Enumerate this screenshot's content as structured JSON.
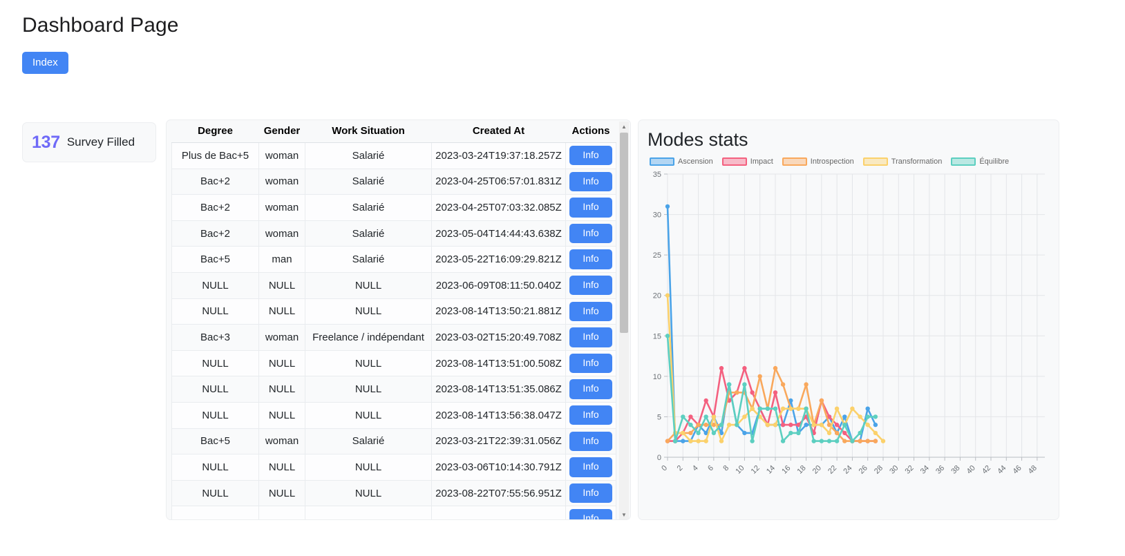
{
  "header": {
    "title": "Dashboard Page",
    "index_button": "Index"
  },
  "stat_card": {
    "number": "137",
    "label": "Survey Filled",
    "number_color": "#6f6af8"
  },
  "table": {
    "columns": [
      "Degree",
      "Gender",
      "Work Situation",
      "Created At",
      "Actions"
    ],
    "action_label": "Info",
    "action_color": "#4285f4",
    "rows": [
      {
        "degree": "Plus de Bac+5",
        "gender": "woman",
        "work": "Salarié",
        "created": "2023-03-24T19:37:18.257Z"
      },
      {
        "degree": "Bac+2",
        "gender": "woman",
        "work": "Salarié",
        "created": "2023-04-25T06:57:01.831Z"
      },
      {
        "degree": "Bac+2",
        "gender": "woman",
        "work": "Salarié",
        "created": "2023-04-25T07:03:32.085Z"
      },
      {
        "degree": "Bac+2",
        "gender": "woman",
        "work": "Salarié",
        "created": "2023-05-04T14:44:43.638Z"
      },
      {
        "degree": "Bac+5",
        "gender": "man",
        "work": "Salarié",
        "created": "2023-05-22T16:09:29.821Z"
      },
      {
        "degree": "NULL",
        "gender": "NULL",
        "work": "NULL",
        "created": "2023-06-09T08:11:50.040Z"
      },
      {
        "degree": "NULL",
        "gender": "NULL",
        "work": "NULL",
        "created": "2023-08-14T13:50:21.881Z"
      },
      {
        "degree": "Bac+3",
        "gender": "woman",
        "work": "Freelance / indépendant",
        "created": "2023-03-02T15:20:49.708Z"
      },
      {
        "degree": "NULL",
        "gender": "NULL",
        "work": "NULL",
        "created": "2023-08-14T13:51:00.508Z"
      },
      {
        "degree": "NULL",
        "gender": "NULL",
        "work": "NULL",
        "created": "2023-08-14T13:51:35.086Z"
      },
      {
        "degree": "NULL",
        "gender": "NULL",
        "work": "NULL",
        "created": "2023-08-14T13:56:38.047Z"
      },
      {
        "degree": "Bac+5",
        "gender": "woman",
        "work": "Salarié",
        "created": "2023-03-21T22:39:31.056Z"
      },
      {
        "degree": "NULL",
        "gender": "NULL",
        "work": "NULL",
        "created": "2023-03-06T10:14:30.791Z"
      },
      {
        "degree": "NULL",
        "gender": "NULL",
        "work": "NULL",
        "created": "2023-08-22T07:55:56.951Z"
      },
      {
        "degree": "",
        "gender": "",
        "work": "",
        "created": ""
      }
    ]
  },
  "chart_data": {
    "type": "line",
    "title": "Modes stats",
    "xlabel": "",
    "ylabel": "",
    "grid": true,
    "legend_position": "top-left",
    "ylim": [
      0,
      35
    ],
    "yticks": [
      0,
      5,
      10,
      15,
      20,
      25,
      30,
      35
    ],
    "xlim": [
      0,
      49
    ],
    "xticks": [
      0,
      2,
      4,
      6,
      8,
      10,
      12,
      14,
      16,
      18,
      20,
      22,
      24,
      26,
      28,
      30,
      32,
      34,
      36,
      38,
      40,
      42,
      44,
      46,
      48
    ],
    "x": [
      0,
      1,
      2,
      3,
      4,
      5,
      6,
      7,
      8,
      9,
      10,
      11,
      12,
      13,
      14,
      15,
      16,
      17,
      18,
      19,
      20,
      21,
      22,
      23,
      24,
      25,
      26,
      27,
      28
    ],
    "series": [
      {
        "name": "Ascension",
        "color": "#4aa3e8",
        "values": [
          31,
          2,
          2,
          2,
          4,
          3,
          5,
          3,
          9,
          4,
          3,
          3,
          6,
          4,
          4,
          4,
          7,
          3,
          4,
          4,
          4,
          5,
          3,
          5,
          2,
          2,
          6,
          4,
          null
        ]
      },
      {
        "name": "Impact",
        "color": "#f4607f",
        "values": [
          2,
          2,
          3,
          5,
          4,
          7,
          5,
          11,
          7,
          8,
          11,
          8,
          6,
          4,
          8,
          4,
          4,
          4,
          5,
          3,
          7,
          5,
          4,
          3,
          2,
          2,
          2,
          2,
          null
        ]
      },
      {
        "name": "Introspection",
        "color": "#f9a85c",
        "values": [
          2,
          3,
          3,
          3,
          4,
          4,
          4,
          4,
          8,
          8,
          8,
          6,
          10,
          6,
          11,
          9,
          6,
          6,
          9,
          4,
          7,
          4,
          3,
          2,
          2,
          2,
          2,
          2,
          null
        ]
      },
      {
        "name": "Transformation",
        "color": "#fbd16b",
        "values": [
          20,
          3,
          3,
          2,
          2,
          2,
          5,
          2,
          4,
          4,
          5,
          6,
          5,
          4,
          4,
          6,
          6,
          6,
          6,
          4,
          4,
          3,
          6,
          4,
          6,
          5,
          4,
          3,
          2
        ]
      },
      {
        "name": "Équilibre",
        "color": "#5ccfc0",
        "values": [
          15,
          2,
          5,
          4,
          3,
          5,
          3,
          4,
          9,
          4,
          9,
          2,
          6,
          6,
          6,
          2,
          3,
          3,
          6,
          2,
          2,
          2,
          2,
          4,
          2,
          3,
          5,
          5,
          null
        ]
      }
    ]
  }
}
